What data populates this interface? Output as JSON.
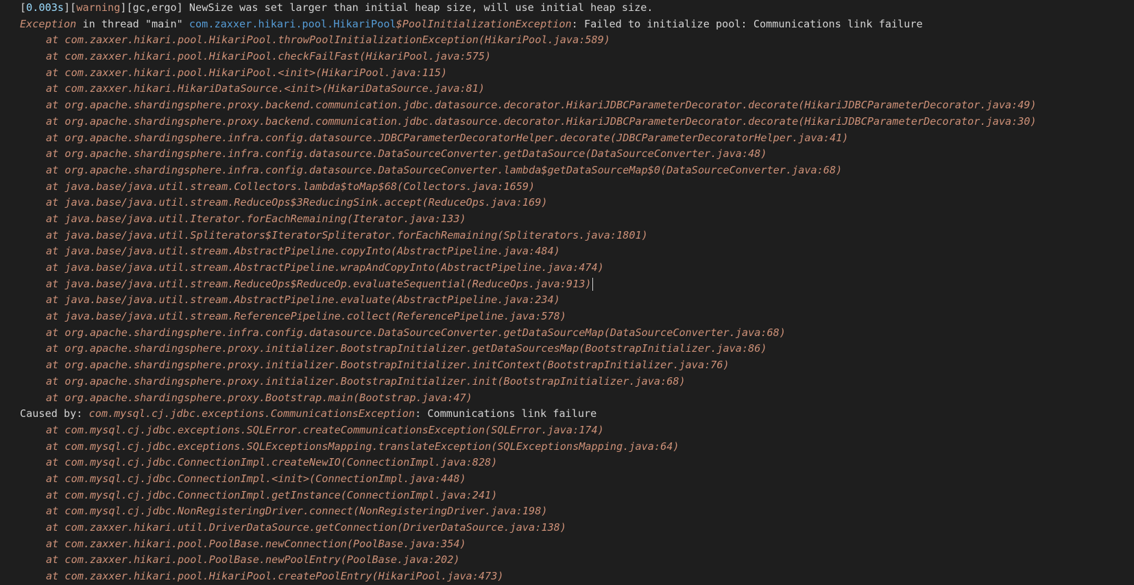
{
  "header": {
    "open_bracket": "[",
    "time": "0.003s",
    "close_open": "][",
    "level": "warning",
    "tags": "][gc,ergo]",
    "message": " NewSize was set larger than initial heap size, will use initial heap size."
  },
  "exception": {
    "prefix": "Exception",
    "thread_text": " in thread \"main\" ",
    "package": "com.zaxxer.hikari.pool.HikariPool",
    "class_suffix": "$PoolInitializationException",
    "message": ": Failed to initialize pool: Communications link failure"
  },
  "frames": [
    "at com.zaxxer.hikari.pool.HikariPool.throwPoolInitializationException(HikariPool.java:589)",
    "at com.zaxxer.hikari.pool.HikariPool.checkFailFast(HikariPool.java:575)",
    "at com.zaxxer.hikari.pool.HikariPool.<init>(HikariPool.java:115)",
    "at com.zaxxer.hikari.HikariDataSource.<init>(HikariDataSource.java:81)",
    "at org.apache.shardingsphere.proxy.backend.communication.jdbc.datasource.decorator.HikariJDBCParameterDecorator.decorate(HikariJDBCParameterDecorator.java:49)",
    "at org.apache.shardingsphere.proxy.backend.communication.jdbc.datasource.decorator.HikariJDBCParameterDecorator.decorate(HikariJDBCParameterDecorator.java:30)",
    "at org.apache.shardingsphere.infra.config.datasource.JDBCParameterDecoratorHelper.decorate(JDBCParameterDecoratorHelper.java:41)",
    "at org.apache.shardingsphere.infra.config.datasource.DataSourceConverter.getDataSource(DataSourceConverter.java:48)",
    "at org.apache.shardingsphere.infra.config.datasource.DataSourceConverter.lambda$getDataSourceMap$0(DataSourceConverter.java:68)",
    "at java.base/java.util.stream.Collectors.lambda$toMap$68(Collectors.java:1659)",
    "at java.base/java.util.stream.ReduceOps$3ReducingSink.accept(ReduceOps.java:169)",
    "at java.base/java.util.Iterator.forEachRemaining(Iterator.java:133)",
    "at java.base/java.util.Spliterators$IteratorSpliterator.forEachRemaining(Spliterators.java:1801)",
    "at java.base/java.util.stream.AbstractPipeline.copyInto(AbstractPipeline.java:484)",
    "at java.base/java.util.stream.AbstractPipeline.wrapAndCopyInto(AbstractPipeline.java:474)",
    "at java.base/java.util.stream.ReduceOps$ReduceOp.evaluateSequential(ReduceOps.java:913)",
    "at java.base/java.util.stream.AbstractPipeline.evaluate(AbstractPipeline.java:234)",
    "at java.base/java.util.stream.ReferencePipeline.collect(ReferencePipeline.java:578)",
    "at org.apache.shardingsphere.infra.config.datasource.DataSourceConverter.getDataSourceMap(DataSourceConverter.java:68)",
    "at org.apache.shardingsphere.proxy.initializer.BootstrapInitializer.getDataSourcesMap(BootstrapInitializer.java:86)",
    "at org.apache.shardingsphere.proxy.initializer.BootstrapInitializer.initContext(BootstrapInitializer.java:76)",
    "at org.apache.shardingsphere.proxy.initializer.BootstrapInitializer.init(BootstrapInitializer.java:68)",
    "at org.apache.shardingsphere.proxy.Bootstrap.main(Bootstrap.java:47)"
  ],
  "caused_by": {
    "prefix": "Caused by: ",
    "class_name": "com.mysql.cj.jdbc.exceptions.CommunicationsException",
    "message": ": Communications link failure"
  },
  "cause_frames": [
    "at com.mysql.cj.jdbc.exceptions.SQLError.createCommunicationsException(SQLError.java:174)",
    "at com.mysql.cj.jdbc.exceptions.SQLExceptionsMapping.translateException(SQLExceptionsMapping.java:64)",
    "at com.mysql.cj.jdbc.ConnectionImpl.createNewIO(ConnectionImpl.java:828)",
    "at com.mysql.cj.jdbc.ConnectionImpl.<init>(ConnectionImpl.java:448)",
    "at com.mysql.cj.jdbc.ConnectionImpl.getInstance(ConnectionImpl.java:241)",
    "at com.mysql.cj.jdbc.NonRegisteringDriver.connect(NonRegisteringDriver.java:198)",
    "at com.zaxxer.hikari.util.DriverDataSource.getConnection(DriverDataSource.java:138)",
    "at com.zaxxer.hikari.pool.PoolBase.newConnection(PoolBase.java:354)",
    "at com.zaxxer.hikari.pool.PoolBase.newPoolEntry(PoolBase.java:202)",
    "at com.zaxxer.hikari.pool.HikariPool.createPoolEntry(HikariPool.java:473)"
  ],
  "colors": {
    "background": "#1e1e1e",
    "text": "#d4d4d4",
    "frame": "#ce9178",
    "package_link": "#569cd6",
    "number": "#9cdcfe"
  }
}
